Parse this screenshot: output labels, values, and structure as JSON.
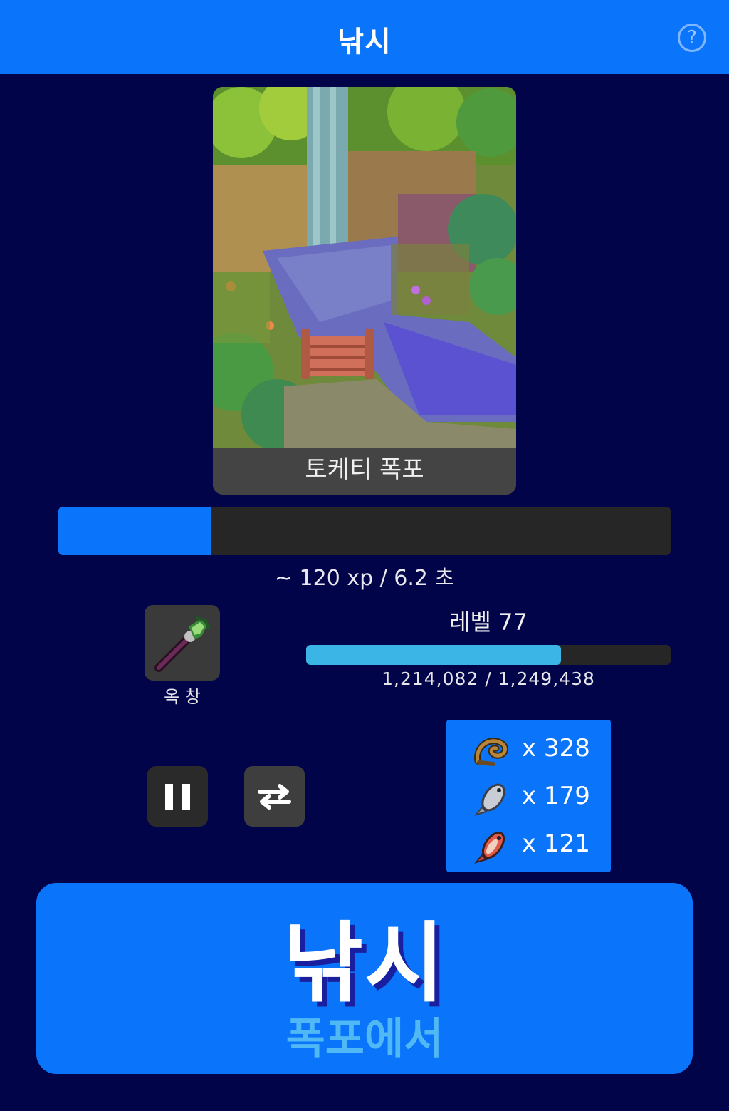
{
  "header": {
    "title": "낚시",
    "help_icon": "question-circle-icon"
  },
  "location": {
    "name": "토케티 폭포",
    "image": "pixel-art waterfall scene"
  },
  "action": {
    "progress_fraction": 0.25,
    "rate_text": "~ 120 xp / 6.2 초"
  },
  "tool": {
    "name": "옥 창",
    "icon": "jade-spear-icon"
  },
  "level": {
    "label": "레벨 77",
    "current_xp": 1214082,
    "next_xp": 1249438,
    "xp_text": "1,214,082 / 1,249,438",
    "progress_fraction": 0.7
  },
  "controls": {
    "pause_icon": "pause-icon",
    "swap_icon": "swap-arrows-icon"
  },
  "loot": [
    {
      "icon": "eel-icon",
      "count_text": "x 328"
    },
    {
      "icon": "silver-fish-icon",
      "count_text": "x 179"
    },
    {
      "icon": "red-fish-icon",
      "count_text": "x 121"
    }
  ],
  "main_button": {
    "title": "낚시",
    "subtitle": "폭포에서"
  },
  "colors": {
    "background": "#020449",
    "accent": "#0a74fa",
    "level_bar": "#3bb4e6"
  }
}
